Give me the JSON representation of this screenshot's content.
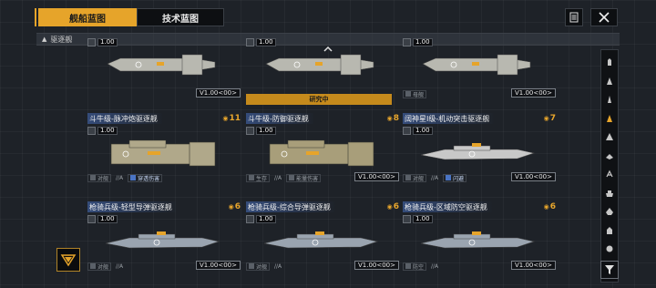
{
  "tabs": {
    "ship_blueprint": "舰船蓝图",
    "tech_blueprint": "技术蓝图"
  },
  "category": {
    "label": "驱逐舰"
  },
  "research_banner": "研究中",
  "colors": {
    "accent": "#e6a42a",
    "title_blue": "#3c5a96",
    "background": "#1e2228"
  },
  "cards": [
    {
      "title": "",
      "level": "1.00",
      "tags": [],
      "version": "V1.00<00>",
      "bars": ""
    },
    {
      "title": "",
      "level": "1.00",
      "tags": [],
      "version": "",
      "bars": ""
    },
    {
      "title": "",
      "level": "1.00",
      "tags": [
        {
          "label": "母舰",
          "style": "plain"
        }
      ],
      "version": "V1.00<00>",
      "bars": ""
    },
    {
      "title": "斗牛级-脉冲炮驱逐舰",
      "level": "1.00",
      "tags": [
        {
          "label": "对舰",
          "style": "plain"
        },
        {
          "label": "//A",
          "style": "none"
        },
        {
          "label": "穿透伤害",
          "style": "blue"
        }
      ],
      "version": "",
      "bars": "11"
    },
    {
      "title": "斗牛级-防御驱逐舰",
      "level": "1.00",
      "tags": [
        {
          "label": "生存",
          "style": "plain"
        },
        {
          "label": "//A",
          "style": "none"
        },
        {
          "label": "能量伤害",
          "style": "plain"
        }
      ],
      "version": "V1.00<00>",
      "bars": "8"
    },
    {
      "title": "阔神星I级-机动突击驱逐舰",
      "level": "1.00",
      "tags": [
        {
          "label": "对舰",
          "style": "plain"
        },
        {
          "label": "//A",
          "style": "none"
        },
        {
          "label": "闪避",
          "style": "blue"
        }
      ],
      "version": "V1.00<00>",
      "bars": "7"
    },
    {
      "title": "枪骑兵级-轻型导弹驱逐舰",
      "level": "1.00",
      "tags": [
        {
          "label": "对舰",
          "style": "plain"
        },
        {
          "label": "//A",
          "style": "none"
        }
      ],
      "version": "V1.00<00>",
      "bars": "6"
    },
    {
      "title": "枪骑兵级-综合导弹驱逐舰",
      "level": "1.00",
      "tags": [
        {
          "label": "对舰",
          "style": "plain"
        },
        {
          "label": "//A",
          "style": "none"
        }
      ],
      "version": "V1.00<00>",
      "bars": "6"
    },
    {
      "title": "枪骑兵级-区域防空驱逐舰",
      "level": "1.00",
      "tags": [
        {
          "label": "防空",
          "style": "plain"
        },
        {
          "label": "//A",
          "style": "none"
        }
      ],
      "version": "V1.00<00>",
      "bars": "6"
    }
  ],
  "side_filters": [
    "all-ship-icon",
    "frigate-icon",
    "corvette-icon",
    "destroyer-icon",
    "cruiser-icon",
    "battlecruiser-icon",
    "auxiliary-icon",
    "carrier-icon",
    "battleship-icon",
    "support-icon",
    "other-icon"
  ],
  "filter_icon": "filter-icon",
  "close_icon": "close-icon",
  "doc_icon": "document-icon"
}
